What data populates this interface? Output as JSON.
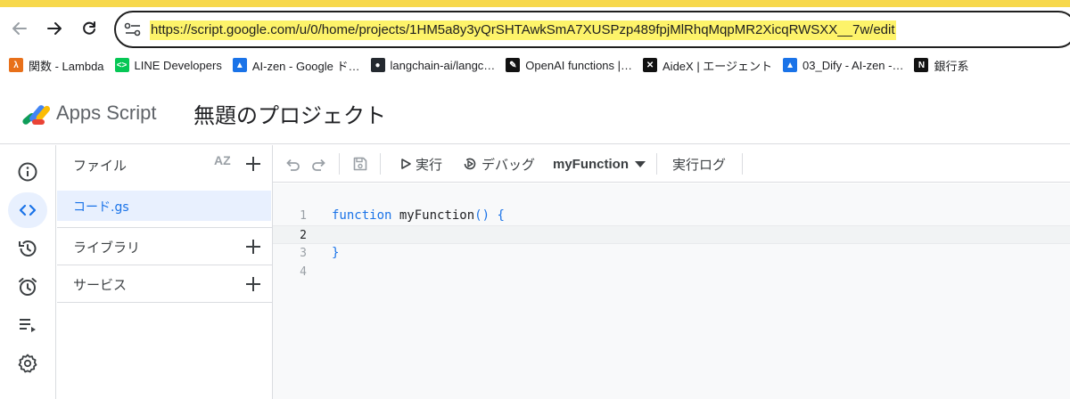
{
  "browser": {
    "url": "https://script.google.com/u/0/home/projects/1HM5a8y3yQrSHTAwkSmA7XUSPzp489fpjMlRhqMqpMR2XicqRWSXX__7w/edit",
    "bookmarks": [
      {
        "label": "関数 - Lambda",
        "icon": "aws-lambda-icon",
        "color": "#e8701a",
        "glyph": "λ"
      },
      {
        "label": "LINE Developers",
        "icon": "line-icon",
        "color": "#06c755",
        "glyph": "<>"
      },
      {
        "label": "AI-zen - Google ド…",
        "icon": "google-drive-icon",
        "color": "#1a73e8",
        "glyph": "▲"
      },
      {
        "label": "langchain-ai/langc…",
        "icon": "github-icon",
        "color": "#24292f",
        "glyph": "●"
      },
      {
        "label": "OpenAI functions |…",
        "icon": "openai-icon",
        "color": "#111111",
        "glyph": "✎"
      },
      {
        "label": "AideX | エージェント",
        "icon": "aidex-icon",
        "color": "#111111",
        "glyph": "✕"
      },
      {
        "label": "03_Dify - AI-zen -…",
        "icon": "google-drive-icon",
        "color": "#1a73e8",
        "glyph": "▲"
      },
      {
        "label": "銀行系",
        "icon": "notion-icon",
        "color": "#111111",
        "glyph": "N"
      }
    ]
  },
  "app": {
    "name": "Apps Script",
    "project_title": "無題のプロジェクト"
  },
  "files_panel": {
    "files_label": "ファイル",
    "sort_label": "AZ",
    "active_file": "コード.gs",
    "libraries_label": "ライブラリ",
    "services_label": "サービス"
  },
  "toolbar": {
    "run_label": "実行",
    "debug_label": "デバッグ",
    "function_name": "myFunction",
    "log_label": "実行ログ"
  },
  "editor": {
    "lines": [
      {
        "num": "1",
        "keyword": "function",
        "rest": " myFunction",
        "punc": "() {"
      },
      {
        "num": "2",
        "keyword": "",
        "rest": "",
        "punc": ""
      },
      {
        "num": "3",
        "keyword": "",
        "rest": "",
        "punc": "}"
      },
      {
        "num": "4",
        "keyword": "",
        "rest": "",
        "punc": ""
      }
    ]
  },
  "colors": {
    "accent": "#1a73e8",
    "url_highlight": "#fdf36a",
    "active_bg": "#e8f0fe"
  }
}
